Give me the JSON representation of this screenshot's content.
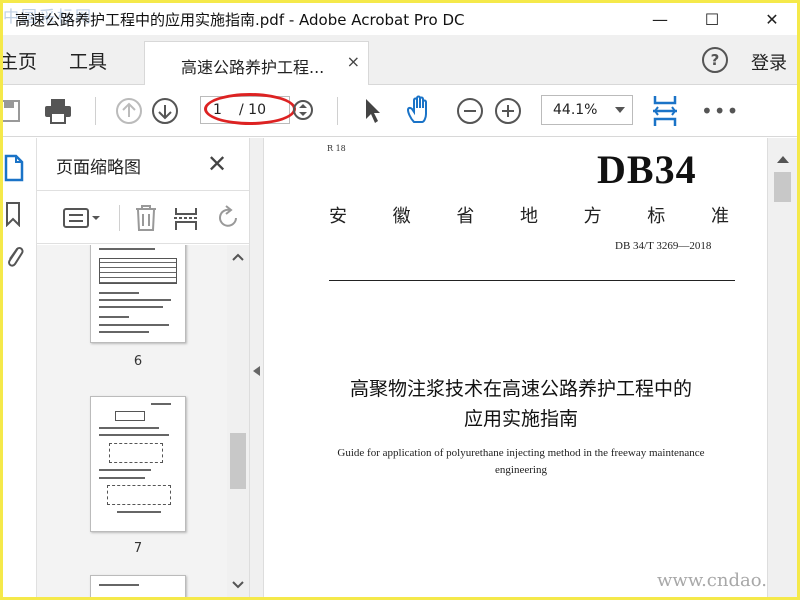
{
  "window": {
    "title": "高速公路养护工程中的应用实施指南.pdf - Adobe Acrobat Pro DC",
    "watermark_top": "中国采标网",
    "minimize": "—",
    "maximize": "☐",
    "close": "✕"
  },
  "tabbar": {
    "home": "主页",
    "tools": "工具",
    "doc_tab": "高速公路养护工程...",
    "doc_tab_close": "×",
    "help": "?",
    "login": "登录"
  },
  "toolbar": {
    "page_current": "1",
    "page_total": "/ 10",
    "zoom": "44.1%",
    "more": "•••"
  },
  "thumbnail_panel": {
    "title": "页面缩略图",
    "close": "✕",
    "pages": [
      "6",
      "7"
    ]
  },
  "document": {
    "code_r18": "R 18",
    "db34": "DB34",
    "province": [
      "安",
      "徽",
      "省",
      "地",
      "方",
      "标",
      "准"
    ],
    "std_number": "DB 34/T  3269—2018",
    "title_line1": "高聚物注浆技术在高速公路养护工程中的",
    "title_line2": "应用实施指南",
    "english_line1": "Guide for application of polyurethane injecting method in the freeway maintenance",
    "english_line2": "engineering",
    "watermark": "www.cndao.com"
  },
  "colors": {
    "frame": "#f5e94a",
    "accent": "#1a73c7",
    "annotation": "#d22222"
  }
}
